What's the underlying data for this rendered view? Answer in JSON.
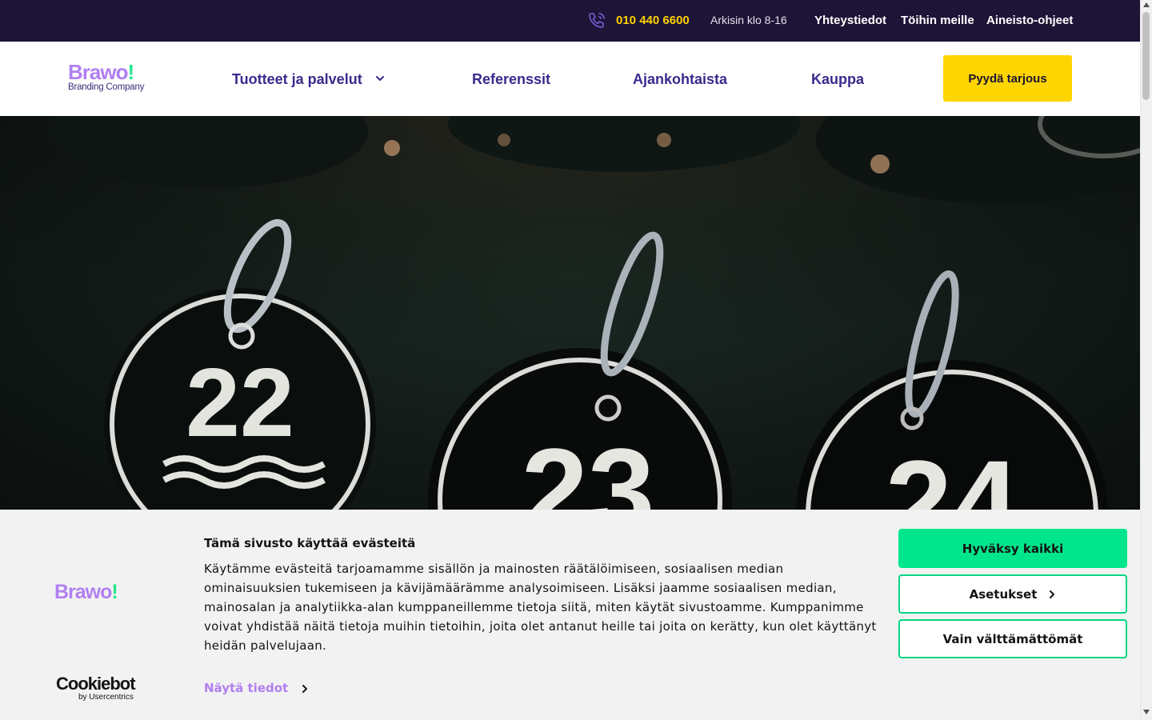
{
  "topbar": {
    "phone_icon": "phone-icon",
    "phone": "010 440 6600",
    "hours": "Arkisin klo 8-16",
    "links": [
      "Yhteystiedot",
      "Töihin meille",
      "Aineisto-ohjeet"
    ]
  },
  "header": {
    "logo": {
      "wordmark": "Brawo",
      "bang": "!",
      "tagline": "Branding Company"
    },
    "nav": [
      "Tuotteet ja palvelut",
      "Referenssit",
      "Ajankohtaista",
      "Kauppa"
    ],
    "cta": "Pyydä tarjous"
  },
  "hero": {
    "tag_numbers": [
      "22",
      "23",
      "24"
    ]
  },
  "cookie": {
    "logo": {
      "wordmark": "Brawo",
      "bang": "!"
    },
    "title": "Tämä sivusto käyttää evästeitä",
    "text": "Käytämme evästeitä tarjoamamme sisällön ja mainosten räätälöimiseen, sosiaalisen median ominaisuuksien tukemiseen ja kävijämäärämme analysoimiseen. Lisäksi jaamme sosiaalisen median, mainosalan ja analytiikka-alan kumppaneillemme tietoja siitä, miten käytät sivustoamme. Kumppanimme voivat yhdistää näitä tietoja muihin tietoihin, joita olet antanut heille tai joita on kerätty, kun olet käyttänyt heidän palvelujaan.",
    "details": "Näytä tiedot",
    "accept": "Hyväksy kaikki",
    "settings": "Asetukset",
    "necessary": "Vain välttämättömät",
    "provider": {
      "name": "Cookiebot",
      "sub": "by Usercentrics"
    }
  },
  "colors": {
    "topbar_bg": "#1e1437",
    "accent_yellow": "#ffd500",
    "brand_purple": "#b07ff0",
    "nav_text": "#3b2a8c",
    "accept_green": "#00e68c"
  }
}
